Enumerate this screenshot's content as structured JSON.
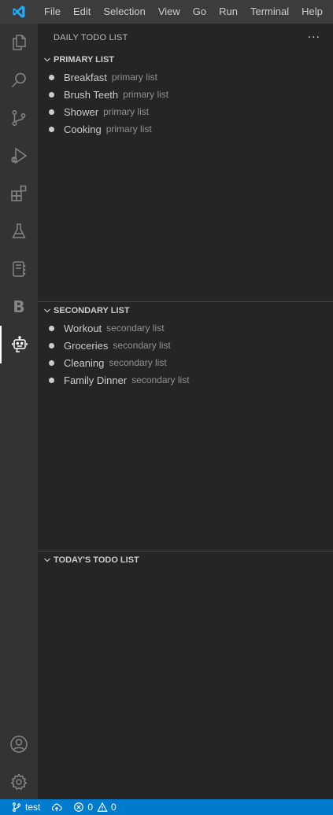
{
  "menu": [
    "File",
    "Edit",
    "Selection",
    "View",
    "Go",
    "Run",
    "Terminal",
    "Help"
  ],
  "activity_bar": {
    "items": [
      "explorer-icon",
      "search-icon",
      "source-control-icon",
      "run-debug-icon",
      "extensions-icon",
      "testing-icon",
      "notebook-icon",
      "b-icon",
      "todo-robot-icon"
    ],
    "b_letter": "B",
    "bottom": [
      "account-icon",
      "settings-gear-icon"
    ]
  },
  "sidebar": {
    "title": "DAILY TODO LIST",
    "more": "···",
    "primary": {
      "title": "PRIMARY LIST",
      "items": [
        {
          "label": "Breakfast",
          "desc": "primary list"
        },
        {
          "label": "Brush Teeth",
          "desc": "primary list"
        },
        {
          "label": "Shower",
          "desc": "primary list"
        },
        {
          "label": "Cooking",
          "desc": "primary list"
        }
      ]
    },
    "secondary": {
      "title": "SECONDARY LIST",
      "items": [
        {
          "label": "Workout",
          "desc": "secondary list"
        },
        {
          "label": "Groceries",
          "desc": "secondary list"
        },
        {
          "label": "Cleaning",
          "desc": "secondary list"
        },
        {
          "label": "Family Dinner",
          "desc": "secondary list"
        }
      ]
    },
    "today": {
      "title": "TODAY'S TODO LIST",
      "items": []
    }
  },
  "statusbar": {
    "branch": "test",
    "errors": "0",
    "warnings": "0"
  },
  "colors": {
    "accent": "#007acc",
    "activity_bar": "#333333",
    "sidebar": "#252526",
    "titlebar": "#3c3c3c"
  }
}
